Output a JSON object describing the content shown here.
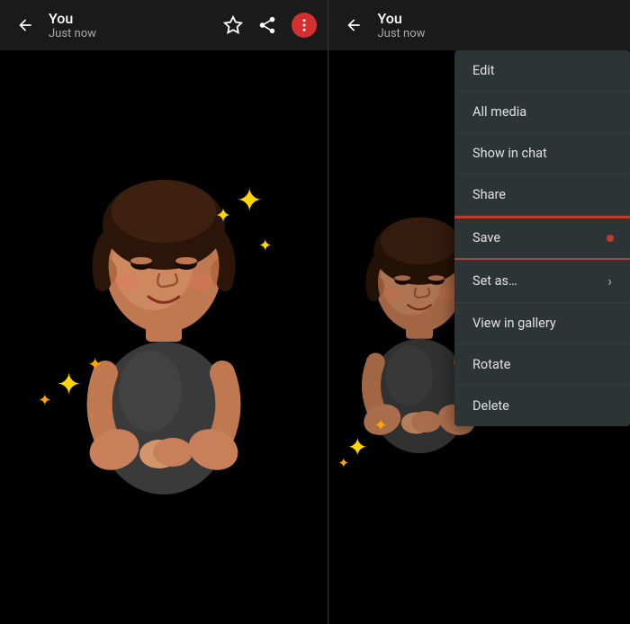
{
  "left_panel": {
    "header": {
      "back_label": "←",
      "user_name": "You",
      "user_status": "Just now",
      "star_icon": "★",
      "share_icon": "↗",
      "more_icon": "⋮"
    }
  },
  "right_panel": {
    "header": {
      "back_label": "←",
      "user_name": "You",
      "user_status": "Just now"
    },
    "context_menu": {
      "items": [
        {
          "id": "edit",
          "label": "Edit",
          "has_chevron": false,
          "has_dot": false
        },
        {
          "id": "all_media",
          "label": "All media",
          "has_chevron": false,
          "has_dot": false
        },
        {
          "id": "show_in_chat",
          "label": "Show in chat",
          "has_chevron": false,
          "has_dot": false
        },
        {
          "id": "share",
          "label": "Share",
          "has_chevron": false,
          "has_dot": false
        },
        {
          "id": "save",
          "label": "Save",
          "has_chevron": false,
          "has_dot": true
        },
        {
          "id": "set_as",
          "label": "Set as…",
          "has_chevron": true,
          "has_dot": false
        },
        {
          "id": "view_in_gallery",
          "label": "View in gallery",
          "has_chevron": false,
          "has_dot": false
        },
        {
          "id": "rotate",
          "label": "Rotate",
          "has_chevron": false,
          "has_dot": false
        },
        {
          "id": "delete",
          "label": "Delete",
          "has_chevron": false,
          "has_dot": false
        }
      ]
    }
  }
}
